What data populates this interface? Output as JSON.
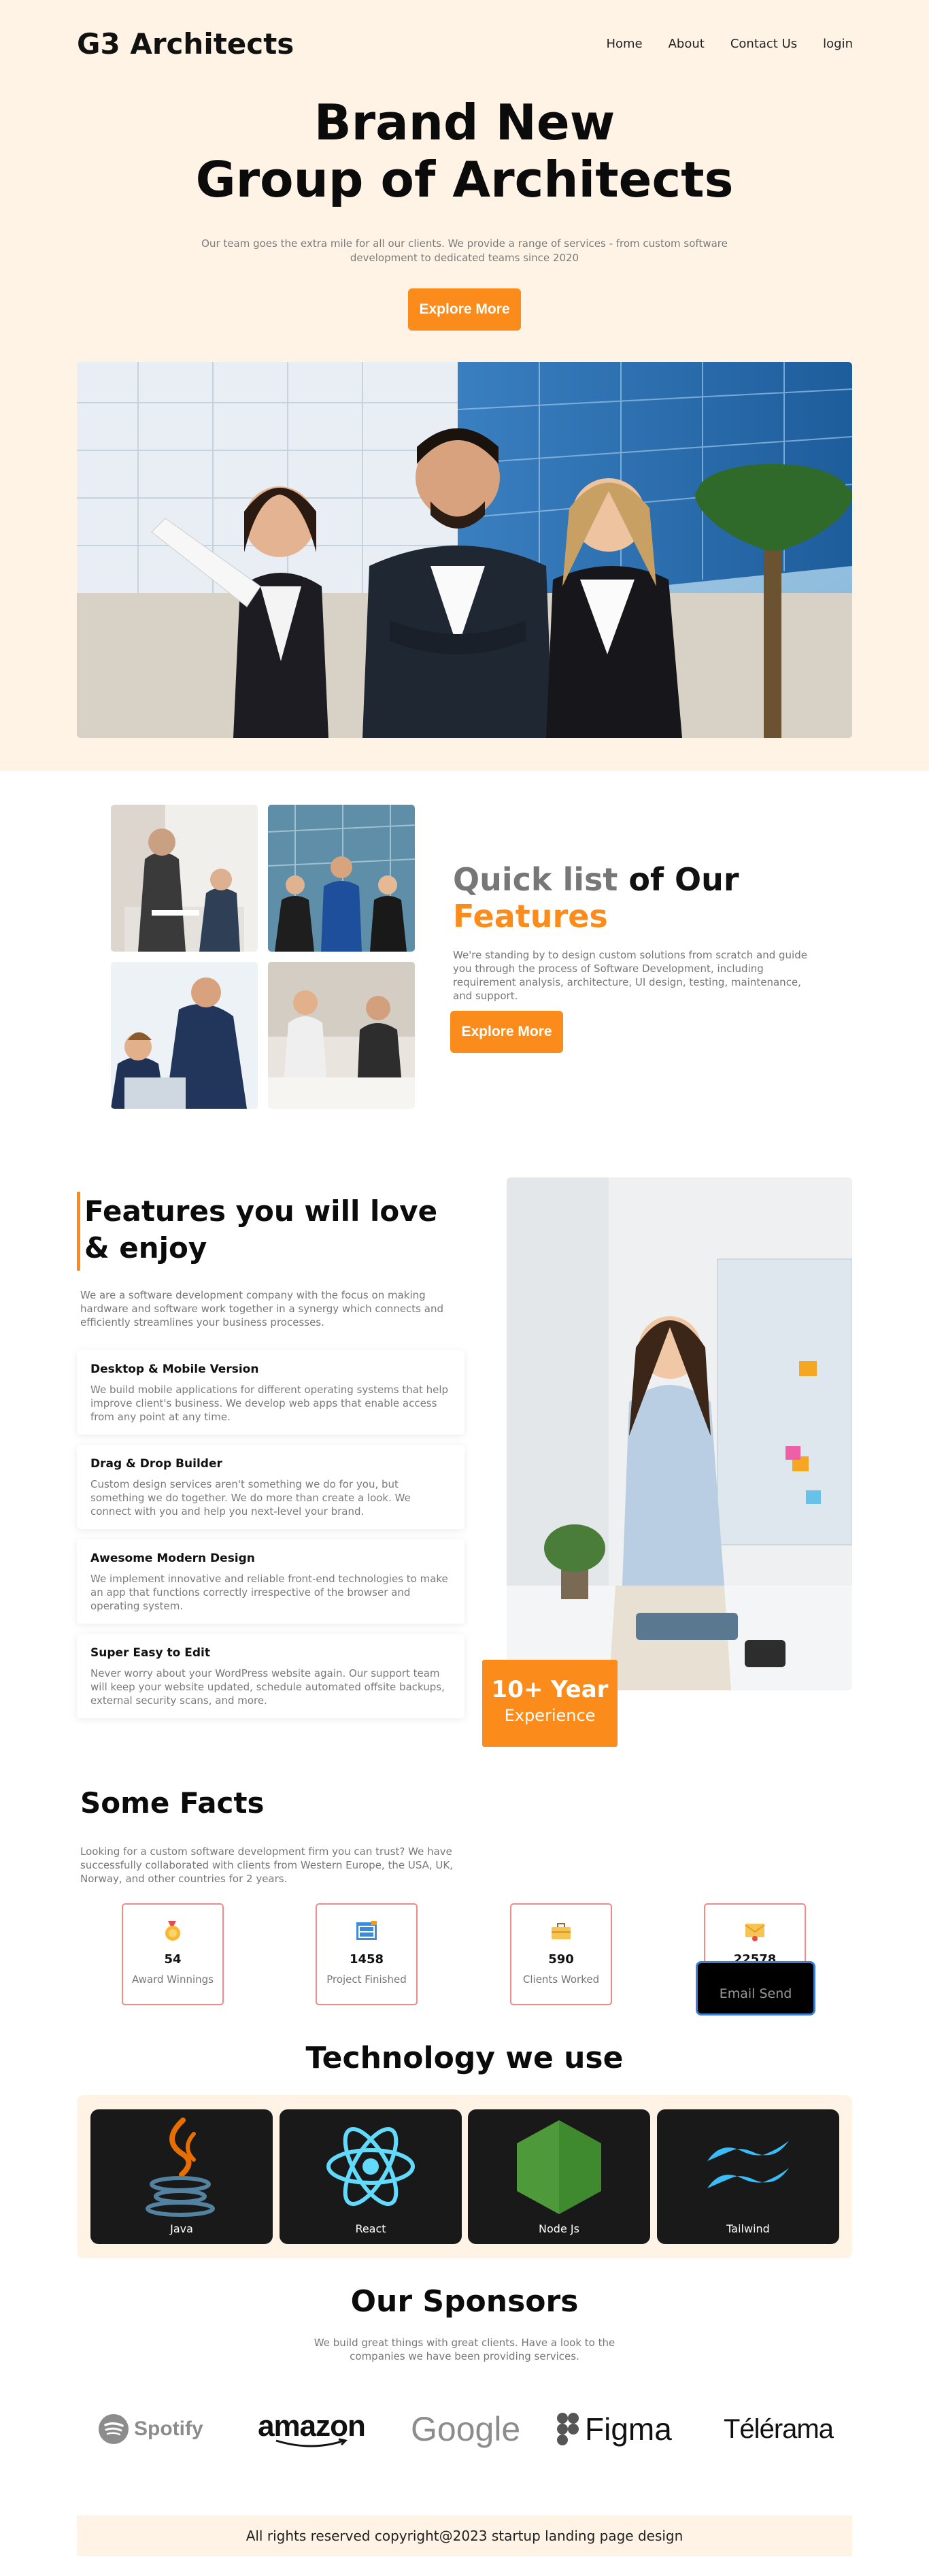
{
  "header": {
    "brand": "G3 Architects",
    "nav": [
      "Home",
      "About",
      "Contact Us",
      "login"
    ]
  },
  "hero": {
    "title_line1": "Brand New",
    "title_line2": "Group of Architects",
    "subtitle": "Our team goes the extra mile for all our clients. We provide a range of services - from custom software development to dedicated teams since 2020",
    "button": "Explore More"
  },
  "quick_list": {
    "title_light": "Quick list ",
    "title_bold": "of Our",
    "title_orange": "Features",
    "description": "We're standing by to design custom solutions from scratch and guide you through the process of Software Development, including requirement analysis, architecture, UI design, testing, maintenance, and support.",
    "button": "Explore More"
  },
  "features": {
    "title": "Features you will love & enjoy",
    "intro": "We are a software development company with the focus on making hardware and software work together in a synergy which connects and efficiently streamlines your business processes.",
    "cards": [
      {
        "title": "Desktop & Mobile Version",
        "text": "We build mobile applications for different operating systems that help improve client's business. We develop web apps that enable access from any point at any time."
      },
      {
        "title": "Drag & Drop Builder",
        "text": "Custom design services aren't something we do for you, but something we do together. We do more than create a look. We connect with you and help you next-level your brand."
      },
      {
        "title": "Awesome Modern Design",
        "text": "We implement innovative and reliable front-end technologies to make an app that functions correctly irrespective of the browser and operating system."
      },
      {
        "title": "Super Easy to Edit",
        "text": "Never worry about your WordPress website again. Our support team will keep your website updated, schedule automated offsite backups, external security scans, and more."
      }
    ],
    "experience_big": "10+ Year",
    "experience_small": "Experience"
  },
  "facts": {
    "title": "Some Facts",
    "description": "Looking for a custom software development firm you can trust? We have successfully collaborated with clients from Western Europe, the USA, UK, Norway, and other countries for 2 years.",
    "items": [
      {
        "value": "54",
        "label": "Award Winnings",
        "icon": "medal-icon"
      },
      {
        "value": "1458",
        "label": "Project Finished",
        "icon": "blueprint-icon"
      },
      {
        "value": "590",
        "label": "Clients Worked",
        "icon": "briefcase-icon"
      },
      {
        "value": "22578",
        "label": "",
        "icon": "mail-icon"
      }
    ],
    "tooltip": "Email Send"
  },
  "technology": {
    "title": "Technology we use",
    "items": [
      "Java",
      "React",
      "Node Js",
      "Tailwind"
    ]
  },
  "sponsors": {
    "title": "Our Sponsors",
    "description": "We build great things with great clients. Have a look to the companies we have been providing services.",
    "logos": [
      "Spotify",
      "amazon",
      "Google",
      "Figma",
      "Télérama"
    ]
  },
  "footer": {
    "text": "All rights reserved copyright@2023 startup landing page design"
  },
  "colors": {
    "accent": "#fb8c1b",
    "cream": "#fef3e4",
    "dark_card": "#191919"
  }
}
